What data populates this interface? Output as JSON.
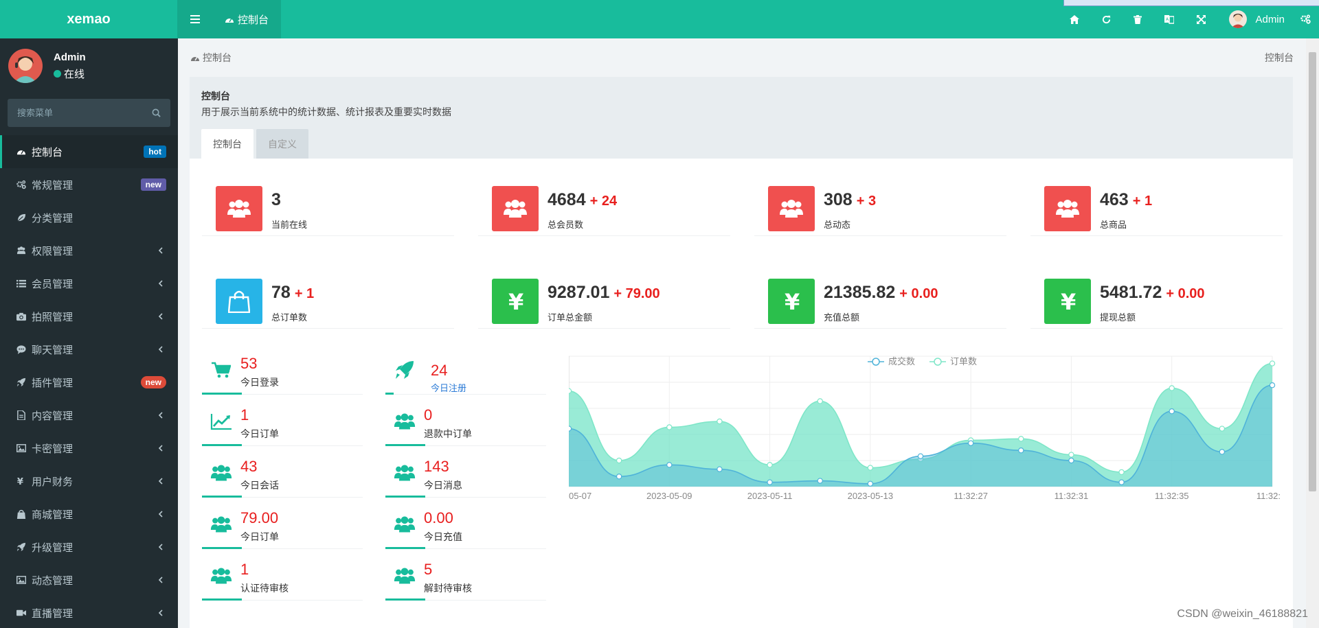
{
  "app": {
    "logo_text": "xemao"
  },
  "user": {
    "name": "Admin",
    "status": "在线"
  },
  "search": {
    "placeholder": "搜索菜单"
  },
  "sidebar": {
    "items": [
      {
        "label": "控制台",
        "icon": "dashboard-icon",
        "badge": "hot",
        "active": true
      },
      {
        "label": "常规管理",
        "icon": "cogs-icon",
        "badge": "new"
      },
      {
        "label": "分类管理",
        "icon": "leaf-icon"
      },
      {
        "label": "权限管理",
        "icon": "group-icon",
        "submenu": true
      },
      {
        "label": "会员管理",
        "icon": "list-icon",
        "submenu": true
      },
      {
        "label": "拍照管理",
        "icon": "camera-icon",
        "submenu": true
      },
      {
        "label": "聊天管理",
        "icon": "comment-icon",
        "submenu": true
      },
      {
        "label": "插件管理",
        "icon": "rocket-icon",
        "badge": "new"
      },
      {
        "label": "内容管理",
        "icon": "file-icon",
        "submenu": true
      },
      {
        "label": "卡密管理",
        "icon": "image-icon",
        "submenu": true
      },
      {
        "label": "用户财务",
        "icon": "yen-icon",
        "submenu": true
      },
      {
        "label": "商城管理",
        "icon": "shopping-bag-icon",
        "submenu": true
      },
      {
        "label": "升级管理",
        "icon": "rocket-icon",
        "submenu": true
      },
      {
        "label": "动态管理",
        "icon": "image-icon",
        "submenu": true
      },
      {
        "label": "直播管理",
        "icon": "video-icon",
        "submenu": true
      }
    ]
  },
  "header": {
    "tab_label": "控制台",
    "user_name": "Admin"
  },
  "breadcrumb": {
    "left": "控制台",
    "right": "控制台"
  },
  "panel": {
    "title": "控制台",
    "description": "用于展示当前系统中的统计数据、统计报表及重要实时数据",
    "tabs": [
      "控制台",
      "自定义"
    ]
  },
  "stats": [
    {
      "value": "3",
      "inc": "",
      "label": "当前在线",
      "color": "#f0504f",
      "icon": "users-icon"
    },
    {
      "value": "4684",
      "inc": "+ 24",
      "label": "总会员数",
      "color": "#f0504f",
      "icon": "users-icon"
    },
    {
      "value": "308",
      "inc": "+ 3",
      "label": "总动态",
      "color": "#f0504f",
      "icon": "users-icon"
    },
    {
      "value": "463",
      "inc": "+ 1",
      "label": "总商品",
      "color": "#f0504f",
      "icon": "users-icon"
    },
    {
      "value": "78",
      "inc": "+ 1",
      "label": "总订单数",
      "color": "#27b4e7",
      "icon": "shopping-bag-icon"
    },
    {
      "value": "9287.01",
      "inc": "+ 79.00",
      "label": "订单总金额",
      "color": "#2bbf4c",
      "icon": "yen-icon"
    },
    {
      "value": "21385.82",
      "inc": "+ 0.00",
      "label": "充值总额",
      "color": "#2bbf4c",
      "icon": "yen-icon"
    },
    {
      "value": "5481.72",
      "inc": "+ 0.00",
      "label": "提现总额",
      "color": "#2bbf4c",
      "icon": "yen-icon"
    }
  ],
  "mini_stats": [
    {
      "value": "53",
      "label": "今日登录",
      "icon": "cart-icon"
    },
    {
      "value": "24",
      "label": "今日注册",
      "icon": "rocket-icon"
    },
    {
      "value": "1",
      "label": "今日订单",
      "icon": "area-chart-icon"
    },
    {
      "value": "0",
      "label": "退款中订单",
      "icon": "users-icon"
    },
    {
      "value": "43",
      "label": "今日会话",
      "icon": "users-icon"
    },
    {
      "value": "143",
      "label": "今日消息",
      "icon": "users-icon"
    },
    {
      "value": "79.00",
      "label": "今日订单",
      "icon": "users-icon"
    },
    {
      "value": "0.00",
      "label": "今日充值",
      "icon": "users-icon"
    },
    {
      "value": "1",
      "label": "认证待审核",
      "icon": "users-icon"
    },
    {
      "value": "5",
      "label": "解封待审核",
      "icon": "users-icon"
    }
  ],
  "watermark": "CSDN @weixin_46188821",
  "colors": {
    "brand": "#18bc9c",
    "sidebar_bg": "#222d32",
    "danger": "#f0504f",
    "info": "#27b4e7",
    "success": "#2bbf4c"
  },
  "chart_data": {
    "type": "area",
    "series": [
      {
        "name": "成交数",
        "color": "#4fb3d9",
        "values": [
          4,
          0.7,
          1.5,
          1.2,
          0.3,
          0.4,
          0.2,
          2.1,
          3,
          2.5,
          1.8,
          0.3,
          5.2,
          2.4,
          7
        ]
      },
      {
        "name": "订单数",
        "color": "#7ee6c8",
        "values": [
          6.6,
          1.8,
          4.1,
          4.5,
          1.5,
          5.9,
          1.3,
          1.9,
          3.2,
          3.3,
          2.2,
          1,
          6.8,
          4,
          8.5
        ]
      }
    ],
    "tick_labels": [
      "05-07",
      "2023-05-09",
      "2023-05-11",
      "2023-05-13",
      "11:32:27",
      "11:32:31",
      "11:32:35",
      "11:32:"
    ],
    "legend_position": "top-center"
  }
}
